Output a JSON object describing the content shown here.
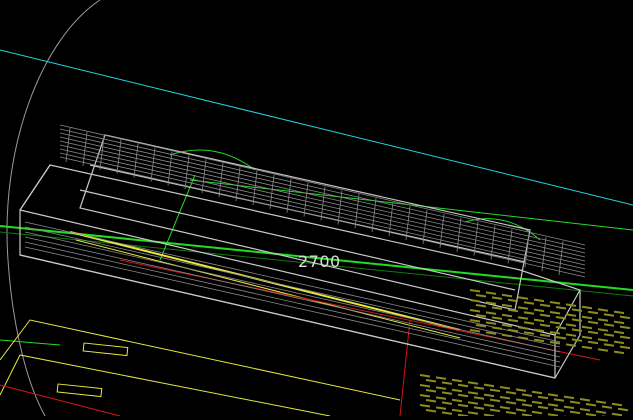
{
  "viewport": {
    "background": "#000000",
    "dimension_label": "2700",
    "colors": {
      "cyan_line": "#1fd6e0",
      "green": "#22dd22",
      "dark_green": "#0c7a0c",
      "white_wire": "#c8c8c8",
      "grey_wire": "#8a8a8a",
      "yellow": "#e6e640",
      "olive": "#8c8c1e",
      "red": "#d01818",
      "circle": "#9a9a9a"
    }
  }
}
